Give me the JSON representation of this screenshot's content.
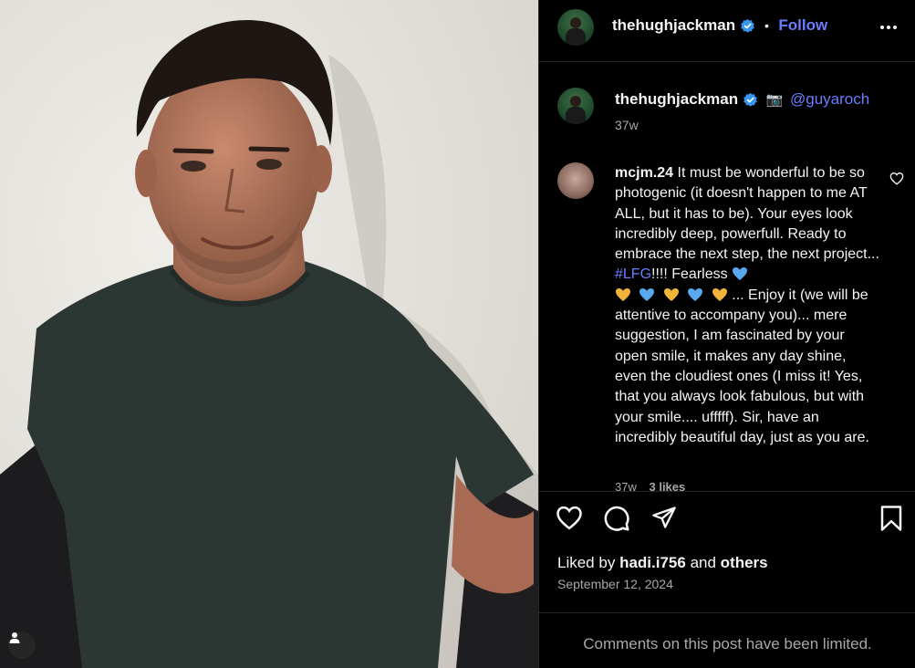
{
  "post": {
    "author": {
      "username": "thehughjackman",
      "verified": true,
      "follow_label": "Follow",
      "separator": "•"
    },
    "caption": {
      "username": "thehughjackman",
      "camera_emoji": "📷",
      "mention": "@guyaroch",
      "age": "37w"
    },
    "comment": {
      "username": "mcjm.24",
      "text_part1": "It must be wonderful to be so photogenic (it doesn't happen to me AT ALL, but it has to be). Your eyes look incredibly deep, powerfull. Ready to embrace the next step, the next project...",
      "hashtag": "#LFG",
      "text_part2": "!!!! Fearless",
      "text_part3": "... Enjoy it (we will be attentive to accompany you)... mere suggestion, I am fascinated by your open smile, it makes any day shine, even the cloudiest ones (I miss it! Yes, that you always look fabulous, but with your smile.... ufffff). Sir, have an incredibly beautiful day, just as you are.",
      "hearts_line1": [
        "blue"
      ],
      "hearts_line2": [
        "yellow",
        "blue",
        "yellow",
        "blue",
        "yellow"
      ],
      "age": "37w",
      "likes": "3 likes"
    },
    "liked_by": {
      "prefix": "Liked by",
      "user": "hadi.i756",
      "and": "and",
      "others": "others"
    },
    "date": "September 12, 2024",
    "comments_limited": "Comments on this post have been limited."
  },
  "icons": [
    "verified-badge-icon",
    "more-options-icon",
    "heart-icon",
    "comment-icon",
    "share-icon",
    "save-icon",
    "user-tag-icon",
    "camera-icon"
  ],
  "colors": {
    "accent": "#6b7dff",
    "muted": "#a8a8a8",
    "background": "#000000",
    "divider": "#262626",
    "heart_blue": "#5aa9ee",
    "heart_yellow": "#f3b43c"
  }
}
